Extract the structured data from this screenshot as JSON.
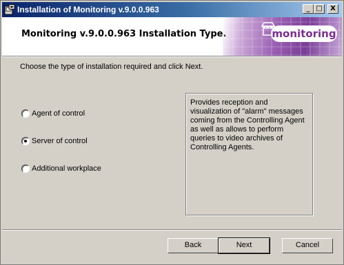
{
  "window": {
    "title": "Installation of Monitoring v.9.0.0.963",
    "controls": {
      "minimize": "_",
      "maximize": "□",
      "close": "X"
    }
  },
  "banner": {
    "title": "Monitoring v.9.0.0.963 Installation Type.",
    "logo_text": "monitoring",
    "colors": {
      "accent": "#7b2e8f"
    }
  },
  "instruction": "Choose the type of installation required and click Next.",
  "options": [
    {
      "label": "Agent of control",
      "checked": false
    },
    {
      "label": "Server of control",
      "checked": true
    },
    {
      "label": "Additional workplace",
      "checked": false
    }
  ],
  "description": "Provides reception and visualization of \"alarm\" messages coming from the Controlling Agent as well as allows to perform queries to video archives of Controlling Agents.",
  "buttons": {
    "back": "Back",
    "next": "Next",
    "cancel": "Cancel"
  }
}
